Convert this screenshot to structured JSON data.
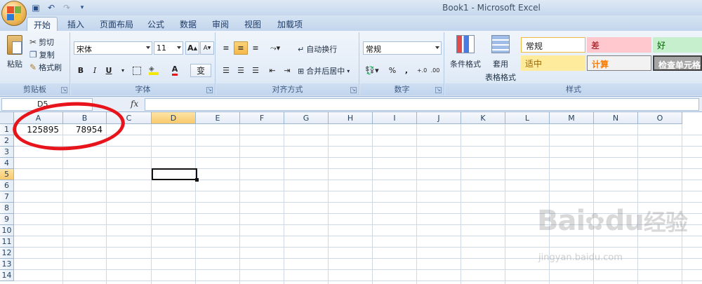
{
  "window": {
    "title": "Book1 - Microsoft Excel"
  },
  "quick_access": [
    "save-icon",
    "undo-icon",
    "redo-icon",
    "customize-icon"
  ],
  "tabs": [
    {
      "label": "开始",
      "active": true
    },
    {
      "label": "插入"
    },
    {
      "label": "页面布局"
    },
    {
      "label": "公式"
    },
    {
      "label": "数据"
    },
    {
      "label": "审阅"
    },
    {
      "label": "视图"
    },
    {
      "label": "加载项"
    }
  ],
  "clipboard": {
    "paste": "粘贴",
    "cut": "剪切",
    "copy": "复制",
    "format_painter": "格式刷",
    "label": "剪贴板"
  },
  "font": {
    "name": "宋体",
    "size": "11",
    "bold": "B",
    "italic": "I",
    "underline": "U",
    "grow": "A",
    "shrink": "A",
    "font_color": "A",
    "phonetic": "变",
    "label": "字体"
  },
  "alignment": {
    "wrap": "自动换行",
    "merge": "合并后居中",
    "label": "对齐方式"
  },
  "number": {
    "format": "常规",
    "percent": "%",
    "comma": ",",
    "label": "数字"
  },
  "styles": {
    "conditional": "条件格式",
    "table_line1": "套用",
    "table_line2": "表格格式",
    "normal": "常规",
    "bad": "差",
    "good": "好",
    "neutral": "适中",
    "calc": "计算",
    "check": "检查单元格",
    "label": "样式"
  },
  "formula_bar": {
    "name_box": "D5",
    "fx": "fx",
    "value": ""
  },
  "columns": [
    "A",
    "B",
    "C",
    "D",
    "E",
    "F",
    "G",
    "H",
    "I",
    "J",
    "K",
    "L",
    "M",
    "N",
    "O"
  ],
  "rows": [
    "1",
    "2",
    "3",
    "4",
    "5",
    "6",
    "7",
    "8",
    "9",
    "10",
    "11",
    "12",
    "13",
    "14"
  ],
  "cells": {
    "A1": "125895",
    "B1": "78954"
  },
  "selected_cell": "D5",
  "watermark": {
    "brand": "Bai",
    "brand2": "du",
    "cn": "经验",
    "url": "jingyan.baidu.com"
  },
  "colors": {
    "annotation": "#e8141b",
    "selection": "#f8c96b"
  }
}
